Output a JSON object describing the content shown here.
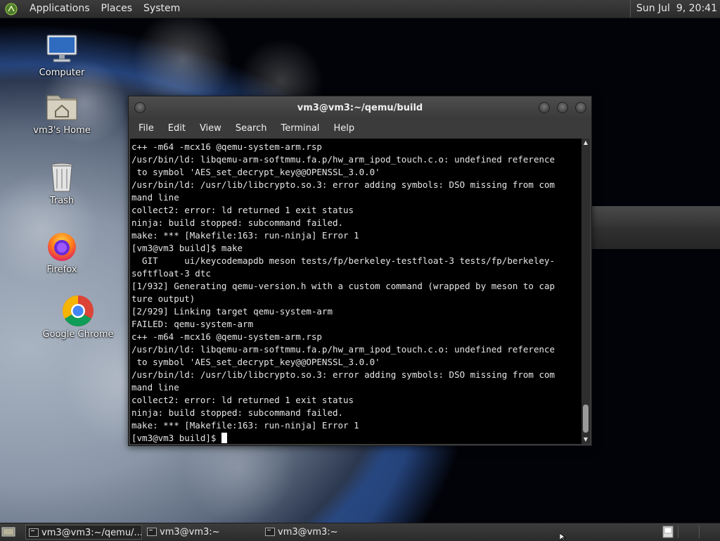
{
  "top_panel": {
    "menus": [
      "Applications",
      "Places",
      "System"
    ],
    "clock": "Sun Jul  9, 20:41"
  },
  "desktop_icons": [
    {
      "label": "Computer",
      "icon": "computer-icon"
    },
    {
      "label": "vm3's Home",
      "icon": "home-folder-icon"
    },
    {
      "label": "Trash",
      "icon": "trash-icon"
    },
    {
      "label": "Firefox",
      "icon": "firefox-icon"
    },
    {
      "label": "Google Chrome",
      "icon": "chrome-icon"
    }
  ],
  "terminal": {
    "title": "vm3@vm3:~/qemu/build",
    "menus": [
      "File",
      "Edit",
      "View",
      "Search",
      "Terminal",
      "Help"
    ],
    "output": "c++ -m64 -mcx16 @qemu-system-arm.rsp\n/usr/bin/ld: libqemu-arm-softmmu.fa.p/hw_arm_ipod_touch.c.o: undefined reference\n to symbol 'AES_set_decrypt_key@@OPENSSL_3.0.0'\n/usr/bin/ld: /usr/lib/libcrypto.so.3: error adding symbols: DSO missing from com\nmand line\ncollect2: error: ld returned 1 exit status\nninja: build stopped: subcommand failed.\nmake: *** [Makefile:163: run-ninja] Error 1\n[vm3@vm3 build]$ make\n  GIT     ui/keycodemapdb meson tests/fp/berkeley-testfloat-3 tests/fp/berkeley-\nsoftfloat-3 dtc\n[1/932] Generating qemu-version.h with a custom command (wrapped by meson to cap\nture output)\n[2/929] Linking target qemu-system-arm\nFAILED: qemu-system-arm\nc++ -m64 -mcx16 @qemu-system-arm.rsp\n/usr/bin/ld: libqemu-arm-softmmu.fa.p/hw_arm_ipod_touch.c.o: undefined reference\n to symbol 'AES_set_decrypt_key@@OPENSSL_3.0.0'\n/usr/bin/ld: /usr/lib/libcrypto.so.3: error adding symbols: DSO missing from com\nmand line\ncollect2: error: ld returned 1 exit status\nninja: build stopped: subcommand failed.\nmake: *** [Makefile:163: run-ninja] Error 1\n",
    "prompt": "[vm3@vm3 build]$ "
  },
  "taskbar": {
    "tasks": [
      {
        "label": "vm3@vm3:~/qemu/...",
        "active": true
      },
      {
        "label": "vm3@vm3:~",
        "active": false
      },
      {
        "label": "vm3@vm3:~",
        "active": false
      }
    ]
  },
  "colors": {
    "panel": "#2b2b2b",
    "terminal_bg": "#000000",
    "terminal_fg": "#e6e6e6"
  }
}
